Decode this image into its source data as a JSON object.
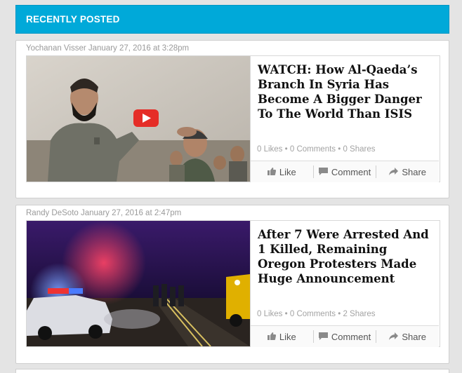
{
  "section": {
    "title": "RECENTLY POSTED"
  },
  "posts": [
    {
      "byline": "Yochanan Visser January 27, 2016 at 3:28pm",
      "title": "WATCH: How Al-Qaeda’s Branch In Syria Has Become A Bigger Danger To The World Than ISIS",
      "stats": "0 Likes • 0 Comments • 0 Shares",
      "thumbnail_icon": "video-play-icon",
      "actions": {
        "like": "Like",
        "comment": "Comment",
        "share": "Share"
      }
    },
    {
      "byline": "Randy DeSoto January 27, 2016 at 2:47pm",
      "title": "After 7 Were Arrested And 1 Killed, Remaining Oregon Protesters Made Huge Announcement",
      "stats": "0 Likes • 0 Comments • 2 Shares",
      "actions": {
        "like": "Like",
        "comment": "Comment",
        "share": "Share"
      }
    }
  ],
  "colors": {
    "header_bg": "#00a9d9",
    "play_button": "#e52d27",
    "page_bg": "#e4e4e4"
  }
}
